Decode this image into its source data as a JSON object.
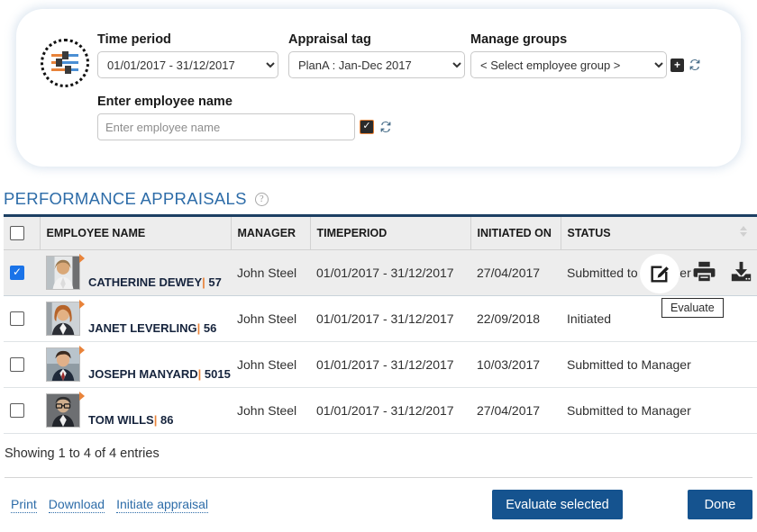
{
  "filters": {
    "icon": "filter-sliders-icon",
    "time_period": {
      "label": "Time period",
      "value": "01/01/2017 - 31/12/2017"
    },
    "appraisal_tag": {
      "label": "Appraisal tag",
      "value": "PlanA : Jan-Dec 2017"
    },
    "manage_groups": {
      "label": "Manage groups",
      "value": "< Select employee group >",
      "add_icon": "plus-square-icon",
      "refresh_icon": "refresh-icon"
    },
    "employee_name": {
      "label": "Enter employee name",
      "value": "",
      "placeholder": "Enter employee name",
      "confirm_icon": "checkbox-checked-icon",
      "refresh_icon": "refresh-icon"
    }
  },
  "section": {
    "title": "PERFORMANCE APPRAISALS",
    "help_icon": "help-circle-icon"
  },
  "table": {
    "columns": [
      "EMPLOYEE NAME",
      "MANAGER",
      "TIMEPERIOD",
      "INITIATED ON",
      "STATUS"
    ],
    "sort_icon": "sort-updown-icon",
    "rows": [
      {
        "selected": true,
        "name": "CATHERINE DEWEY",
        "id": "57",
        "manager": "John Steel",
        "timeperiod": "01/01/2017 - 31/12/2017",
        "initiated_on": "27/04/2017",
        "status": "Submitted to Manager"
      },
      {
        "selected": false,
        "name": "JANET LEVERLING",
        "id": "56",
        "manager": "John Steel",
        "timeperiod": "01/01/2017 - 31/12/2017",
        "initiated_on": "22/09/2018",
        "status": "Initiated"
      },
      {
        "selected": false,
        "name": "JOSEPH MANYARD",
        "id": "5015",
        "manager": "John Steel",
        "timeperiod": "01/01/2017 - 31/12/2017",
        "initiated_on": "10/03/2017",
        "status": "Submitted to Manager"
      },
      {
        "selected": false,
        "name": "TOM WILLS",
        "id": "86",
        "manager": "John Steel",
        "timeperiod": "01/01/2017 - 31/12/2017",
        "initiated_on": "27/04/2017",
        "status": "Submitted to Manager"
      }
    ]
  },
  "row_actions": {
    "evaluate_icon": "edit-pencil-icon",
    "print_icon": "printer-icon",
    "download_icon": "download-icon",
    "tooltip": "Evaluate"
  },
  "footer": {
    "entries": "Showing 1 to 4 of 4 entries",
    "links": [
      "Print",
      "Download",
      "Initiate appraisal"
    ],
    "evaluate_button": "Evaluate selected",
    "done_button": "Done"
  },
  "colors": {
    "accent_blue": "#15538f",
    "title_blue": "#2d6ca8",
    "orange": "#e8833a",
    "header_border": "#1c3f63",
    "checkbox_blue": "#1a73e8"
  }
}
